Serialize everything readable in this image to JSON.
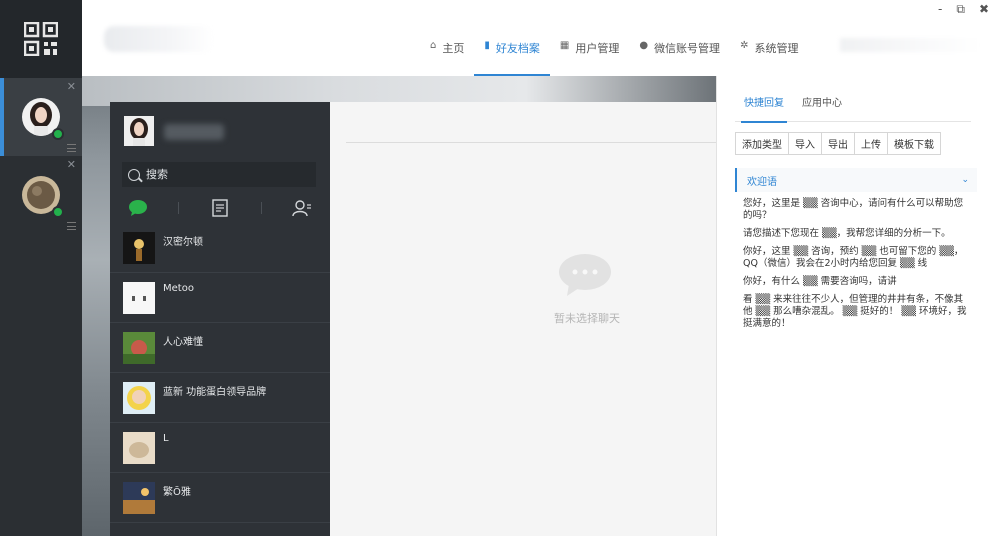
{
  "window_controls": {
    "minimize": "-",
    "restore": "⧉",
    "close": "✖"
  },
  "nav": [
    {
      "icon": "home-icon",
      "glyph": "⌂",
      "label": "主页",
      "active": false
    },
    {
      "icon": "document-icon",
      "glyph": "▮",
      "label": "好友档案",
      "active": true
    },
    {
      "icon": "grid-icon",
      "glyph": "▦",
      "label": "用户管理",
      "active": false
    },
    {
      "icon": "chat-icon",
      "glyph": "●",
      "label": "微信账号管理",
      "active": false
    },
    {
      "icon": "gear-icon",
      "glyph": "✲",
      "label": "系统管理",
      "active": false
    }
  ],
  "search": {
    "placeholder": "搜索"
  },
  "contacts": [
    {
      "name": "汉密尔顿"
    },
    {
      "name": "Metoo"
    },
    {
      "name": "人心难懂"
    },
    {
      "name": "蓝新 功能蛋白领导品牌"
    },
    {
      "name": "L"
    },
    {
      "name": "繁Ō雅"
    }
  ],
  "conversation": {
    "empty_text": "暂未选择聊天"
  },
  "right_panel": {
    "tabs": [
      {
        "label": "快捷回复",
        "active": true
      },
      {
        "label": "应用中心",
        "active": false
      }
    ],
    "buttons": [
      "添加类型",
      "导入",
      "导出",
      "上传",
      "模板下载"
    ],
    "group_title": "欢迎语",
    "messages": [
      "您好，这里是 ▒▒ 咨询中心，请问有什么可以帮助您的吗？",
      "请您描述下您现在 ▒▒，我帮您详细的分析一下。",
      "你好，这里 ▒▒ 咨询，预约 ▒▒ 也可留下您的 ▒▒，QQ（微信）我会在2小时内给您回复 ▒▒ 线",
      "你好，有什么 ▒▒ 需要咨询吗，请讲",
      "看 ▒▒ 来来往往不少人，但管理的井井有条，不像其他 ▒▒ 那么嘈杂混乱。 ▒▒ 挺好的！ ▒▒ 环境好，我挺满意的！"
    ]
  },
  "colors": {
    "accent": "#2f85d3",
    "online": "#22b14c",
    "sidebar": "#2b2f33",
    "list_bg": "#2e3237"
  }
}
